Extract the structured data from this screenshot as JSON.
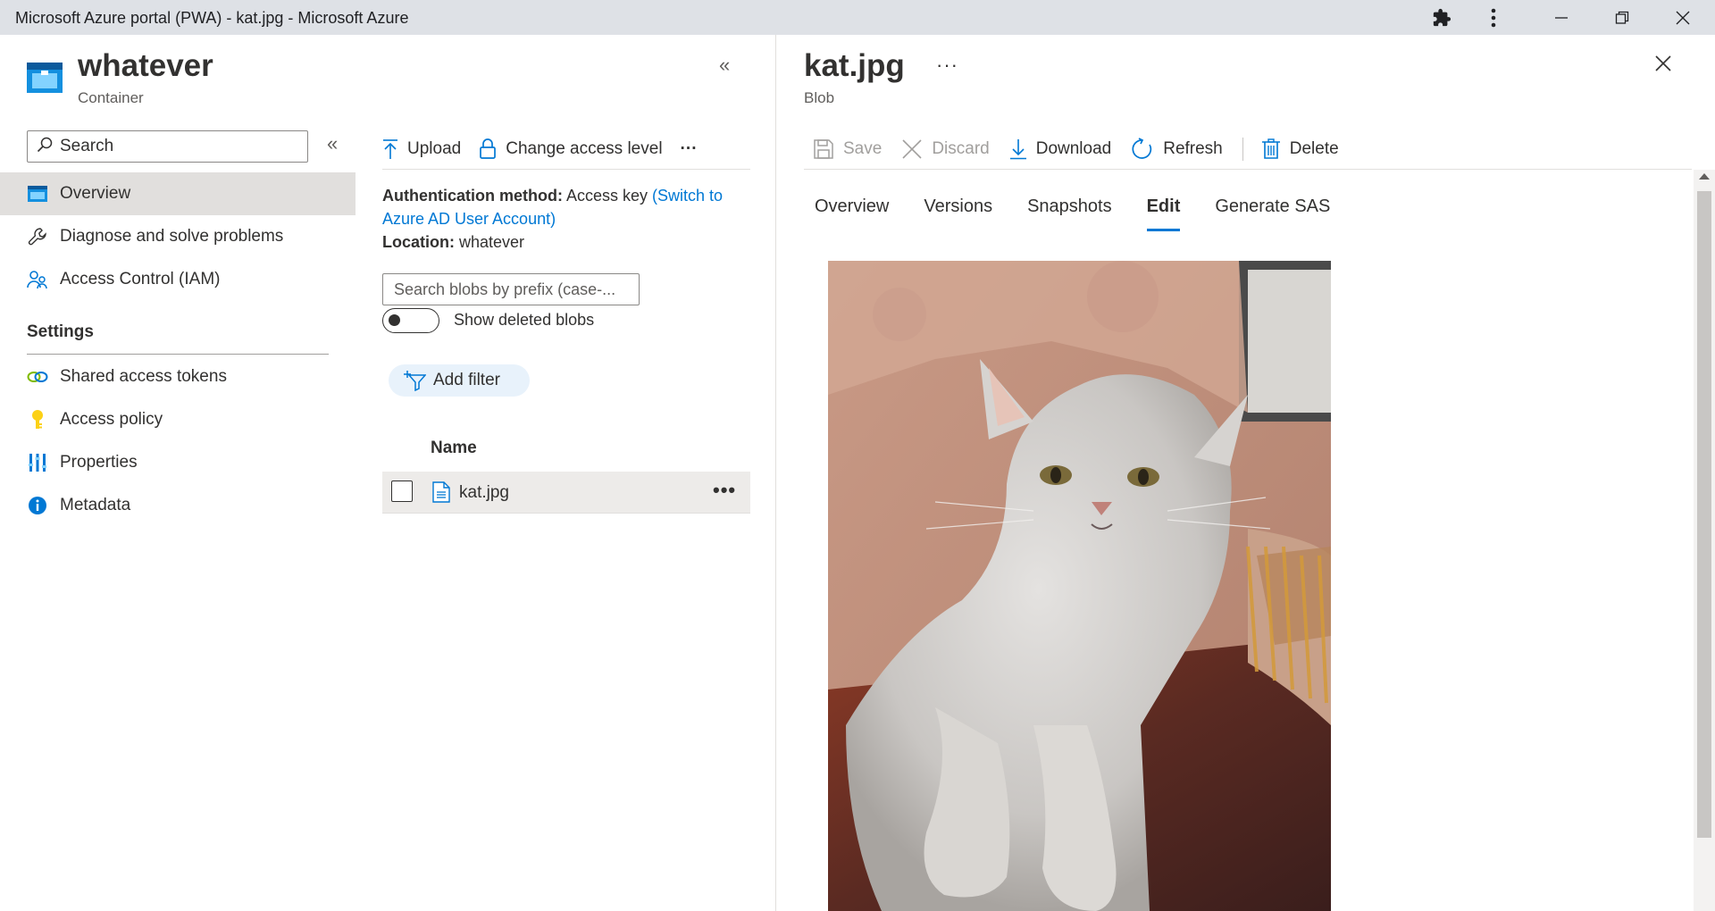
{
  "window": {
    "title": "Microsoft Azure portal (PWA) - kat.jpg - Microsoft Azure"
  },
  "resource": {
    "name": "whatever",
    "type": "Container"
  },
  "left_nav": {
    "search_placeholder": "Search",
    "items": [
      {
        "label": "Overview"
      },
      {
        "label": "Diagnose and solve problems"
      },
      {
        "label": "Access Control (IAM)"
      }
    ],
    "settings_heading": "Settings",
    "settings_items": [
      {
        "label": "Shared access tokens"
      },
      {
        "label": "Access policy"
      },
      {
        "label": "Properties"
      },
      {
        "label": "Metadata"
      }
    ]
  },
  "container_toolbar": {
    "upload": "Upload",
    "change_access": "Change access level",
    "more": "···"
  },
  "container_info": {
    "auth_label": "Authentication method:",
    "auth_value": "Access key",
    "auth_link": "(Switch to Azure AD User Account)",
    "location_label": "Location:",
    "location_value": "whatever"
  },
  "blob_list": {
    "search_placeholder": "Search blobs by prefix (case-...",
    "show_deleted_label": "Show deleted blobs",
    "show_deleted_on": false,
    "add_filter": "Add filter",
    "column_name": "Name",
    "rows": [
      {
        "name": "kat.jpg",
        "more": "•••"
      }
    ]
  },
  "blob_panel": {
    "title": "kat.jpg",
    "subtitle": "Blob",
    "more": "···",
    "toolbar": {
      "save": "Save",
      "discard": "Discard",
      "download": "Download",
      "refresh": "Refresh",
      "delete": "Delete"
    },
    "tabs": [
      {
        "label": "Overview",
        "active": false
      },
      {
        "label": "Versions",
        "active": false
      },
      {
        "label": "Snapshots",
        "active": false
      },
      {
        "label": "Edit",
        "active": true
      },
      {
        "label": "Generate SAS",
        "active": false
      }
    ]
  },
  "colors": {
    "accent": "#0078d4",
    "nav_selected": "#e1dfdd"
  }
}
